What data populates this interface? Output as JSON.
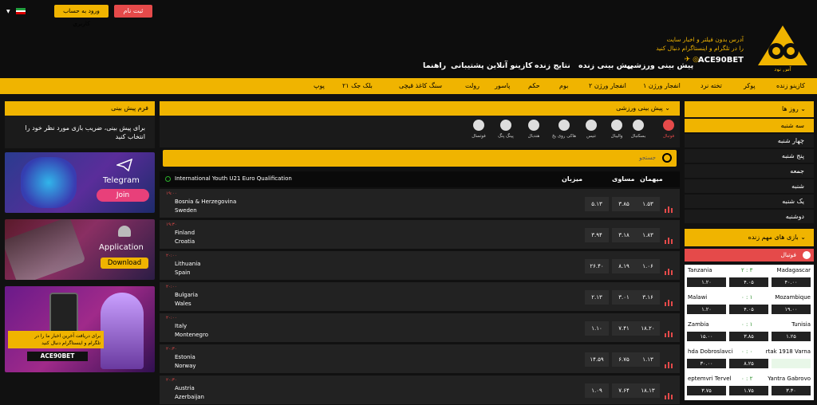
{
  "header": {
    "login_label": "ورود به حساب کاربری",
    "signup_label": "ثبت نام",
    "logo_line1": "آدرس بدون فیلتر و اخبار سایت",
    "logo_line2": "را در تلگرام و اینستاگرام دنبال کنید",
    "logo_brand": "ACE90BET",
    "logo_sub": "آس نود",
    "main_nav": [
      "پیش بینی ورزشی",
      "پیش بینی زنده",
      "نتایج زنده",
      "کازینو آنلاین",
      "پشتیبانی",
      "راهنما"
    ]
  },
  "casino_nav": [
    "کازینو زنده",
    "پوکر",
    "تخته نرد",
    "انفجار ورژن ۱",
    "انفجار ورژن ۲",
    "بوم",
    "حکم",
    "پاسور",
    "رولت",
    "سنگ کاغذ قیچی",
    "بلک جک ۲۱",
    "پوپ"
  ],
  "left_panel": {
    "title": "فرم پیش بینی",
    "body": "برای پیش بینی، ضریب بازی مورد نظر خود را انتخاب کنید",
    "ad_telegram_title": "Telegram",
    "ad_telegram_btn": "Join",
    "ad_app_title": "Application",
    "ad_app_btn": "Download",
    "ad_social_line1": "برای دریافت آخرین اخبار ما را در",
    "ad_social_line2": "تلگرام و اینستاگرام دنبال کنید",
    "ad_social_brand": "ACE90BET"
  },
  "center": {
    "title": "پیش بینی ورزشی",
    "sports": [
      "فوتبال",
      "بسکتبال",
      "والیبال",
      "تنیس",
      "هاکی روی یخ",
      "هندبال",
      "پینگ پنگ",
      "فوتسال"
    ],
    "search_placeholder": "جستجو",
    "league": "International Youth U21 Euro Qualification",
    "col_home": "میزبان",
    "col_draw": "مساوی",
    "col_away": "میهمان",
    "matches": [
      {
        "time": "۱۹:۰۰",
        "home": "Bosnia & Herzegovina",
        "away": "Sweden",
        "o1": "۵.۱۳",
        "ox": "۳.۸۵",
        "o2": "۱.۵۳"
      },
      {
        "time": "۱۹:۳۰",
        "home": "Finland",
        "away": "Croatia",
        "o1": "۳.۹۴",
        "ox": "۳.۱۸",
        "o2": "۱.۸۳"
      },
      {
        "time": "۲۰:۰۰",
        "home": "Lithuania",
        "away": "Spain",
        "o1": "۲۶.۴۰",
        "ox": "۸.۱۹",
        "o2": "۱.۰۶"
      },
      {
        "time": "۲۰:۰۰",
        "home": "Bulgaria",
        "away": "Wales",
        "o1": "۲.۱۳",
        "ox": "۳.۰۱",
        "o2": "۳.۱۶"
      },
      {
        "time": "۲۰:۰۰",
        "home": "Italy",
        "away": "Montenegro",
        "o1": "۱.۱۰",
        "ox": "۷.۴۱",
        "o2": "۱۸.۲۰"
      },
      {
        "time": "۲۰:۳۰",
        "home": "Estonia",
        "away": "Norway",
        "o1": "۱۴.۵۹",
        "ox": "۶.۷۵",
        "o2": "۱.۱۳"
      },
      {
        "time": "۲۰:۳۰",
        "home": "Austria",
        "away": "Azerbaijan",
        "o1": "۱.۰۹",
        "ox": "۷.۶۴",
        "o2": "۱۸.۱۳"
      }
    ]
  },
  "right_panel": {
    "days_title": "روز ها",
    "days": [
      "سه شنبه",
      "چهار شنبه",
      "پنج شنبه",
      "جمعه",
      "شنبه",
      "یک شنبه",
      "دوشنبه"
    ],
    "live_title": "بازی های مهم زنده",
    "live_sport": "فوتبال",
    "live_matches": [
      {
        "t1": "Madagascar",
        "score": "۲ : ۳",
        "t2": "Tanzania",
        "o1": "۴۰.۰۰",
        "ox": "۴.۰۵",
        "o2": "۱.۲۰"
      },
      {
        "t1": "Mozambique",
        "score": "۰ : ۱",
        "t2": "Malawi",
        "o1": "۱۹.۰۰",
        "ox": "۴.۰۵",
        "o2": "۱.۲۰"
      },
      {
        "t1": "Tunisia",
        "score": "۰ : ۱",
        "t2": "Zambia",
        "o1": "۱.۲۵",
        "ox": "۳.۸۵",
        "o2": "۱۵.۰۰"
      },
      {
        "t1": "rtak 1918 Varna",
        "score": "۰ : ۰",
        "t2": "hda Dobroslavci",
        "o1": "",
        "ox": "۸.۲۵",
        "o2": "۳۰.۰۰"
      },
      {
        "t1": "Yantra Gabrovo",
        "score": "۰ : ۲",
        "t2": "eptemvri Tervel",
        "o1": "۳.۳۰",
        "ox": "۱.۷۵",
        "o2": "۳.۷۵"
      }
    ]
  },
  "colors": {
    "accent": "#f0b400",
    "danger": "#e54a4a",
    "bg": "#111111"
  }
}
